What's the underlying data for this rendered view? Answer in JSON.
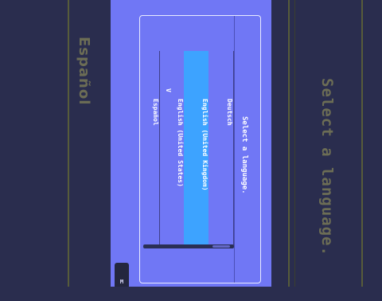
{
  "background": {
    "left_text": "Español",
    "right_text": "Select a language."
  },
  "dialog": {
    "title": "Select a language.",
    "languages": [
      {
        "label": "Deutsch",
        "selected": false,
        "checked": false
      },
      {
        "label": "English (United Kingdom)",
        "selected": true,
        "checked": false
      },
      {
        "label": "English (United States)",
        "selected": false,
        "checked": true
      },
      {
        "label": "Español",
        "selected": false,
        "checked": false
      }
    ],
    "check_mark": "V"
  },
  "corner_tab": {
    "label": "M"
  },
  "colors": {
    "screen_bg": "#7077f5",
    "selected_bg": "#3da3ff",
    "outer_bg": "#2a2d4e"
  }
}
